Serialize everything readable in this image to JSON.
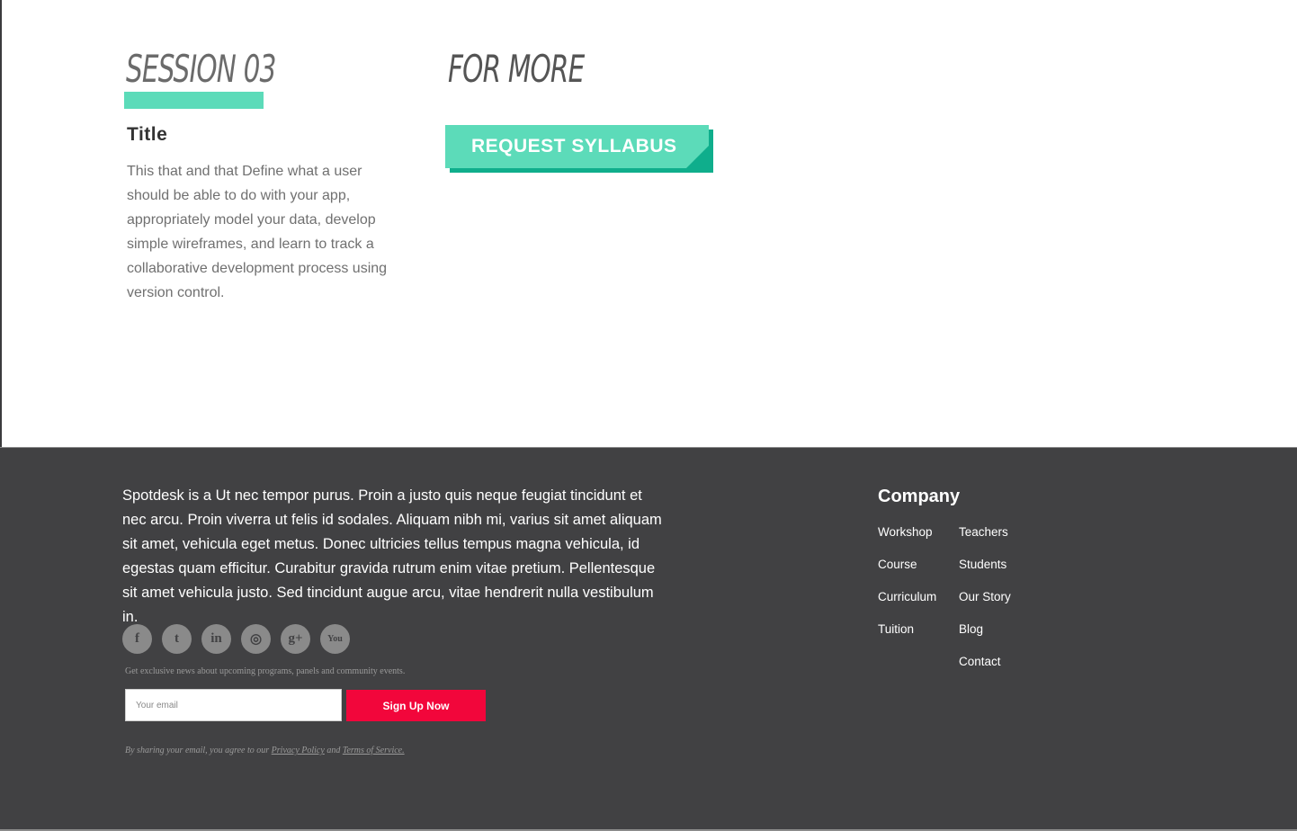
{
  "session": {
    "heading": "SESSION 03",
    "title": "Title",
    "description": "This that and that Define what a user should be able to do with your app, appropriately model your data, develop simple wireframes, and learn to track a collaborative development process using version control."
  },
  "more": {
    "heading": "FOR MORE",
    "button_label": "REQUEST SYLLABUS"
  },
  "footer": {
    "about": "Spotdesk is a Ut nec tempor purus. Proin a justo quis neque feugiat tincidunt et nec arcu. Proin viverra ut felis id sodales. Aliquam nibh mi, varius sit amet aliquam sit amet, vehicula eget metus. Donec ultricies tellus tempus magna vehicula, id egestas quam efficitur. Curabitur gravida rutrum enim vitae pretium. Pellentesque sit amet vehicula justo. Sed tincidunt augue arcu, vitae hendrerit nulla vestibulum in.",
    "social": [
      {
        "icon": "facebook-icon",
        "glyph": "f"
      },
      {
        "icon": "twitter-icon",
        "glyph": "t"
      },
      {
        "icon": "linkedin-icon",
        "glyph": "in"
      },
      {
        "icon": "instagram-icon",
        "glyph": "◎"
      },
      {
        "icon": "google-plus-icon",
        "glyph": "g+"
      },
      {
        "icon": "youtube-icon",
        "glyph": "You"
      }
    ],
    "newsletter_note": "Get exclusive news about upcoming programs, panels and community events.",
    "email_placeholder": "Your email",
    "signup_label": "Sign Up Now",
    "legal_prefix": "By sharing your email, you agree to our ",
    "privacy_label": "Privacy Policy",
    "legal_and": " and ",
    "terms_label": "Terms of Service."
  },
  "company": {
    "heading": "Company",
    "col1": [
      "Workshop",
      "Course",
      "Curriculum",
      "Tuition"
    ],
    "col2": [
      "Teachers",
      "Students",
      "Our Story",
      "Blog",
      "Contact"
    ]
  },
  "colors": {
    "accent": "#5cdbb9",
    "accent_dark": "#0fae8c",
    "footer_bg": "#414143",
    "signup": "#f2063b"
  }
}
